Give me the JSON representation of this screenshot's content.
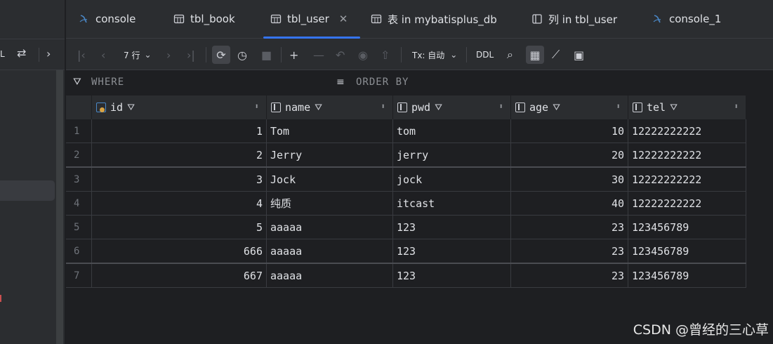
{
  "tabs": [
    {
      "label": "console",
      "icon": "console-icon",
      "active": false
    },
    {
      "label": "tbl_book",
      "icon": "table-icon",
      "active": false
    },
    {
      "label": "tbl_user",
      "icon": "table-icon",
      "active": true
    },
    {
      "label": "表 in mybatisplus_db",
      "icon": "table-icon",
      "active": false
    },
    {
      "label": "列 in tbl_user",
      "icon": "column-icon",
      "active": false
    },
    {
      "label": "console_1",
      "icon": "console-icon",
      "active": false
    }
  ],
  "left_toolbar": {
    "label": "L"
  },
  "toolbar": {
    "rows_label": "7 行",
    "tx_label": "Tx: 自动",
    "ddl_label": "DDL"
  },
  "filters": {
    "where_label": "WHERE",
    "orderby_label": "ORDER BY"
  },
  "grid": {
    "columns": [
      "id",
      "name",
      "pwd",
      "age",
      "tel"
    ],
    "rows": [
      {
        "num": "1",
        "id": "1",
        "name": "Tom",
        "pwd": "tom",
        "age": "10",
        "tel": "12222222222"
      },
      {
        "num": "2",
        "id": "2",
        "name": "Jerry",
        "pwd": "jerry",
        "age": "20",
        "tel": "12222222222"
      },
      {
        "num": "3",
        "id": "3",
        "name": "Jock",
        "pwd": "jock",
        "age": "30",
        "tel": "12222222222"
      },
      {
        "num": "4",
        "id": "4",
        "name": "纯质",
        "pwd": "itcast",
        "age": "40",
        "tel": "12222222222"
      },
      {
        "num": "5",
        "id": "5",
        "name": "aaaaa",
        "pwd": "123",
        "age": "23",
        "tel": "123456789"
      },
      {
        "num": "6",
        "id": "666",
        "name": "aaaaa",
        "pwd": "123",
        "age": "23",
        "tel": "123456789"
      },
      {
        "num": "7",
        "id": "667",
        "name": "aaaaa",
        "pwd": "123",
        "age": "23",
        "tel": "123456789"
      }
    ]
  },
  "watermark": "CSDN @曾经的三心草",
  "colors": {
    "accent": "#3574f0",
    "background": "#1e1f22",
    "panel": "#2b2d30"
  }
}
